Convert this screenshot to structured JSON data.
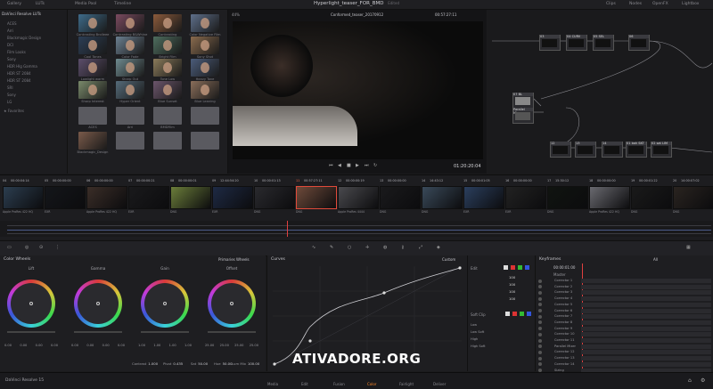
{
  "topbar": {
    "tabs": [
      "Gallery",
      "LUTs",
      "Media Pool",
      "Timeline"
    ],
    "project_title": "Hyperlight_teaser_FOR_BMD",
    "project_state": "Edited",
    "right_items": [
      "Clips",
      "Nodes",
      "OpenFX",
      "Lightbox"
    ]
  },
  "lut_browser": {
    "header": "DaVinci Resolve LUTs",
    "categories": [
      "ACES",
      "Arri",
      "Blackmagic Design",
      "DCI",
      "Film Looks",
      "Sony",
      "HDR Hlg Gamma",
      "HDR ST 2084",
      "HDR ST 2084",
      "SRI",
      "Sony",
      "LG",
      "Favorites"
    ],
    "thumbnails": [
      "Contrasting Brolleee",
      "Contrasting B&Whine",
      "Contrasting Bluecolumn",
      "Color Negative Film",
      "Cool Tones",
      "Color Fade",
      "Bright Film",
      "Sony Shot",
      "Lowlight warm",
      "Sharp Out",
      "Tone Low",
      "Heavy Tone",
      "Sharp Interest",
      "Hyper Orient",
      "Blue Sunset",
      "Blue Leaning"
    ],
    "folders": [
      "ACES",
      "Arri",
      "BMDFilm",
      "",
      ""
    ],
    "more_labels": [
      "Blackmagic_Design",
      "",
      "",
      ""
    ]
  },
  "viewer": {
    "zoom": "44%",
    "clip_name": "Conformed_teaser_20170912",
    "source_tc": "00:57:27:11",
    "clip_tc": "01:20:20:04"
  },
  "nodes": {
    "labels": [
      "03",
      "04 CURV",
      "05 SEL",
      "06",
      "07 BL",
      "Parallel Mixer",
      "12",
      "13",
      "14",
      "01 bah SKT",
      "02 sat LIM"
    ]
  },
  "timeline": {
    "clips": [
      {
        "num": "04",
        "tc": "00:00:04:14",
        "codec": "Apple ProRes 422 HQ"
      },
      {
        "num": "05",
        "tc": "00:00:00:00",
        "codec": "EXR"
      },
      {
        "num": "06",
        "tc": "00:00:00:00",
        "codec": "Apple ProRes 422 HQ"
      },
      {
        "num": "07",
        "tc": "00:00:00:21",
        "codec": "EXR"
      },
      {
        "num": "08",
        "tc": "00:00:00:01",
        "codec": "DNG"
      },
      {
        "num": "09",
        "tc": "12:44:54:20",
        "codec": "EXR"
      },
      {
        "num": "10",
        "tc": "00:00:01:13",
        "codec": "DNG"
      },
      {
        "num": "11",
        "tc": "00:57:27:11",
        "codec": "DNG"
      },
      {
        "num": "12",
        "tc": "00:00:00:19",
        "codec": "Apple ProRes 4444"
      },
      {
        "num": "13",
        "tc": "00:00:00:00",
        "codec": "DNG"
      },
      {
        "num": "14",
        "tc": "14:43:12",
        "codec": "DNG"
      },
      {
        "num": "15",
        "tc": "00:00:01:05",
        "codec": "EXR"
      },
      {
        "num": "16",
        "tc": "00:00:00:00",
        "codec": "EXR"
      },
      {
        "num": "17",
        "tc": "15:30:12",
        "codec": "DNG"
      },
      {
        "num": "18",
        "tc": "00:00:00:00",
        "codec": "Apple ProRes 422 HQ"
      },
      {
        "num": "19",
        "tc": "00:00:01:22",
        "codec": "DNG"
      },
      {
        "num": "20",
        "tc": "14:00:07:02",
        "codec": "DNG"
      }
    ]
  },
  "color_wheels": {
    "title": "Color Wheels",
    "mode": "Primaries Wheels",
    "wheels": [
      {
        "name": "Lift",
        "values": [
          "0.00",
          "0.00",
          "0.00",
          "0.00"
        ]
      },
      {
        "name": "Gamma",
        "values": [
          "0.00",
          "0.00",
          "0.00",
          "0.00"
        ]
      },
      {
        "name": "Gain",
        "values": [
          "1.00",
          "1.00",
          "1.00",
          "1.00"
        ]
      },
      {
        "name": "Offset",
        "values": [
          "25.00",
          "25.00",
          "25.00",
          "25.00"
        ]
      }
    ],
    "params": [
      {
        "label": "Contrast",
        "value": "1.000"
      },
      {
        "label": "Pivot",
        "value": "0.435"
      },
      {
        "label": "Sat",
        "value": "50.00"
      },
      {
        "label": "Hue",
        "value": "50.00"
      },
      {
        "label": "Lum Mix",
        "value": "100.00"
      }
    ]
  },
  "curves": {
    "title": "Curves",
    "mode": "Custom"
  },
  "custom_panel": {
    "edit_label": "Edit",
    "values": [
      "100",
      "100",
      "100",
      "100"
    ],
    "soft_clip_label": "Soft Clip",
    "soft_labels": [
      "Low",
      "Low Soft",
      "High",
      "High Soft"
    ]
  },
  "keyframes": {
    "title": "Keyframes",
    "scope": "All",
    "timecode": "00:00:01:00",
    "master_label": "Master",
    "rows": [
      "Corrector 1",
      "Corrector 2",
      "Corrector 3",
      "Corrector 4",
      "Corrector 5",
      "Corrector 6",
      "Corrector 7",
      "Corrector 8",
      "Corrector 9",
      "Corrector 10",
      "Corrector 11",
      "Parallel Mixer",
      "Corrector 12",
      "Corrector 13",
      "Corrector 14",
      "Sizing"
    ]
  },
  "bottom": {
    "app_name": "DaVinci Resolve 15",
    "pages": [
      "Media",
      "Edit",
      "Fusion",
      "Color",
      "Fairlight",
      "Deliver"
    ],
    "active_page": "Color"
  },
  "watermark": "ATIVADORE.ORG",
  "colors": {
    "accent": "#ff8a2a",
    "background": "#1b1b1d"
  }
}
